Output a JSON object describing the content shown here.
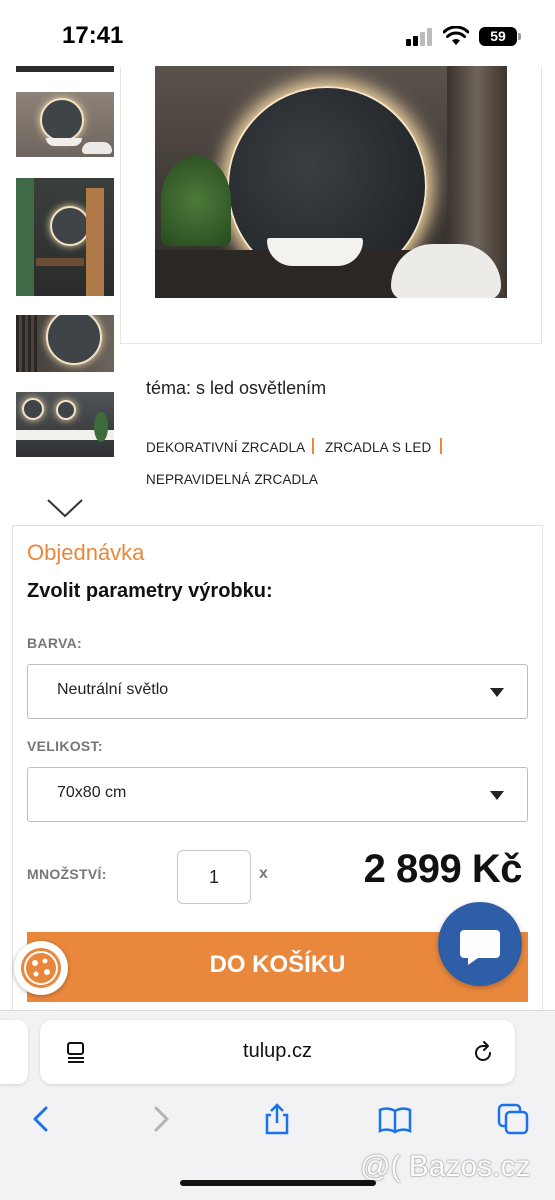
{
  "status_bar": {
    "time": "17:41",
    "battery": "59"
  },
  "gallery": {
    "thumbnails": [
      "thumb-1",
      "thumb-2",
      "thumb-3",
      "thumb-4",
      "thumb-5"
    ]
  },
  "product": {
    "theme": "téma: s led osvětlením",
    "tags": [
      "DEKORATIVNÍ ZRCADLA",
      "ZRCADLA S LED",
      "NEPRAVIDELNÁ ZRCADLA"
    ]
  },
  "order": {
    "title": "Objednávka",
    "params_title": "Zvolit parametry výrobku:",
    "color_label": "BARVA:",
    "color_value": "Neutrální světlo",
    "size_label": "VELIKOST:",
    "size_value": "70x80 cm",
    "quantity_label": "MNOŽSTVÍ:",
    "quantity_value": "1",
    "quantity_x": "x",
    "price": "2 899 Kč",
    "cart_button": "DO KOŠÍKU"
  },
  "browser": {
    "url": "tulup.cz"
  },
  "watermark": "@( Bazos.cz",
  "colors": {
    "accent": "#e9883c",
    "chat": "#2f5ea8"
  }
}
